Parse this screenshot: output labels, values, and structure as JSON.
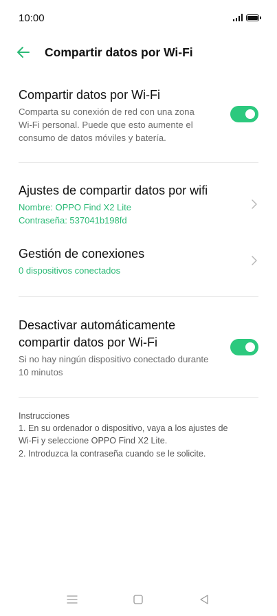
{
  "status_bar": {
    "time": "10:00",
    "icons": [
      "signal-icon",
      "battery-icon"
    ]
  },
  "header": {
    "back_icon": "arrow-left-icon",
    "title": "Compartir datos por Wi-Fi"
  },
  "colors": {
    "accent": "#2bba76",
    "toggle_on": "#2cc97e",
    "text_primary": "#111111",
    "text_secondary": "#6b6b6b",
    "divider": "#e8e8e8"
  },
  "hotspot": {
    "title": "Compartir datos por Wi-Fi",
    "description": "Comparta su conexión de red con una zona\nWi-Fi personal. Puede que esto aumente el\nconsumo de datos móviles y batería.",
    "enabled": true
  },
  "hotspot_settings": {
    "title": "Ajustes de compartir datos por wifi",
    "name_line": "Nombre: OPPO Find X2 Lite",
    "password_line": "Contraseña: 537041b198fd"
  },
  "connections": {
    "title": "Gestión de conexiones",
    "status": "0 dispositivos conectados"
  },
  "auto_off": {
    "title_line1": "Desactivar automáticamente",
    "title_line2": "compartir datos por Wi-Fi",
    "description": "Si no hay ningún dispositivo conectado durante\n10 minutos",
    "enabled": true
  },
  "instructions": {
    "heading": "Instrucciones",
    "step1": "1. En su ordenador o dispositivo, vaya a los ajustes de\nWi-Fi y seleccione OPPO Find X2 Lite.",
    "step2": "2. Introduzca la contraseña cuando se le solicite."
  },
  "nav_bar": {
    "icons": [
      "menu-icon",
      "home-square-icon",
      "back-triangle-icon"
    ]
  }
}
